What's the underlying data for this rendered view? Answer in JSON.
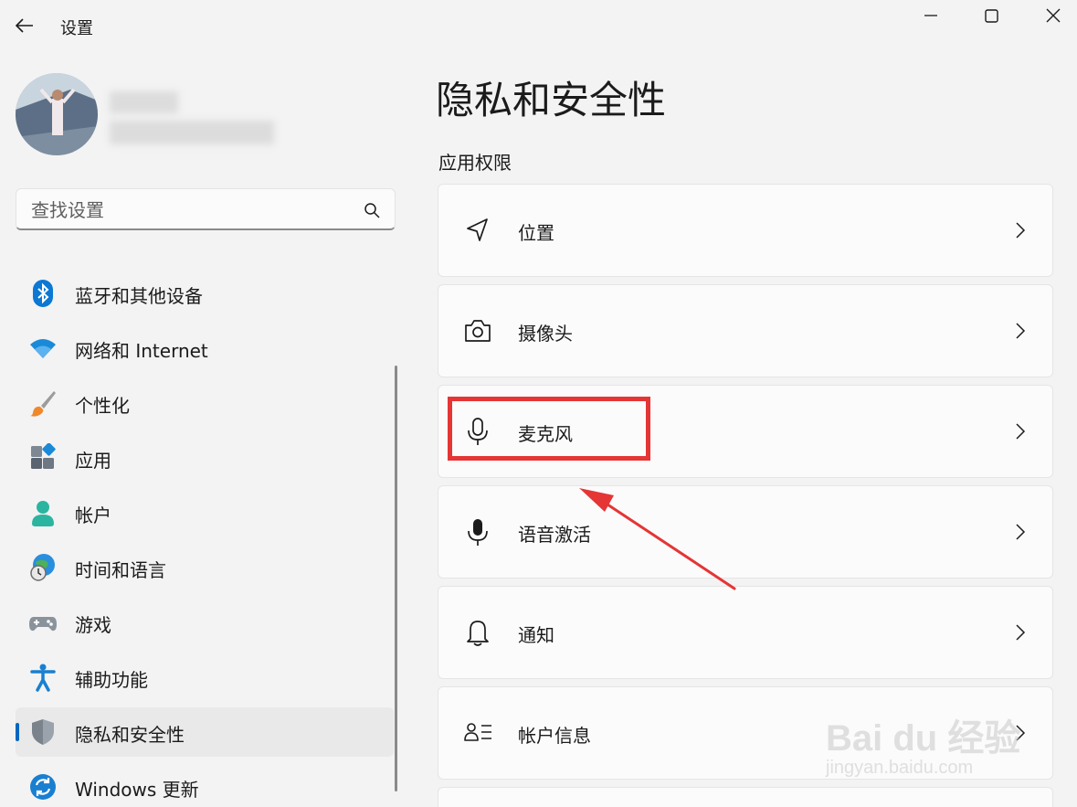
{
  "window": {
    "title": "设置"
  },
  "search": {
    "placeholder": "查找设置"
  },
  "sidebar": {
    "items": [
      {
        "label": "蓝牙和其他设备",
        "icon": "bluetooth-icon"
      },
      {
        "label": "网络和 Internet",
        "icon": "wifi-icon"
      },
      {
        "label": "个性化",
        "icon": "brush-icon"
      },
      {
        "label": "应用",
        "icon": "apps-icon"
      },
      {
        "label": "帐户",
        "icon": "account-icon"
      },
      {
        "label": "时间和语言",
        "icon": "time-language-icon"
      },
      {
        "label": "游戏",
        "icon": "gamepad-icon"
      },
      {
        "label": "辅助功能",
        "icon": "accessibility-icon"
      },
      {
        "label": "隐私和安全性",
        "icon": "shield-icon",
        "active": true
      },
      {
        "label": "Windows 更新",
        "icon": "windows-update-icon"
      }
    ]
  },
  "main": {
    "title": "隐私和安全性",
    "section": "应用权限",
    "items": [
      {
        "label": "位置",
        "icon": "location-icon"
      },
      {
        "label": "摄像头",
        "icon": "camera-icon"
      },
      {
        "label": "麦克风",
        "icon": "microphone-icon"
      },
      {
        "label": "语音激活",
        "icon": "voice-activation-icon"
      },
      {
        "label": "通知",
        "icon": "bell-icon"
      },
      {
        "label": "帐户信息",
        "icon": "account-info-icon"
      }
    ]
  },
  "annotation": {
    "color": "#e53535"
  },
  "watermark": {
    "brand": "Bai du 经验",
    "url": "jingyan.baidu.com"
  },
  "colors": {
    "accent": "#0067c0",
    "background": "#f3f3f3",
    "card": "#fbfbfb"
  }
}
